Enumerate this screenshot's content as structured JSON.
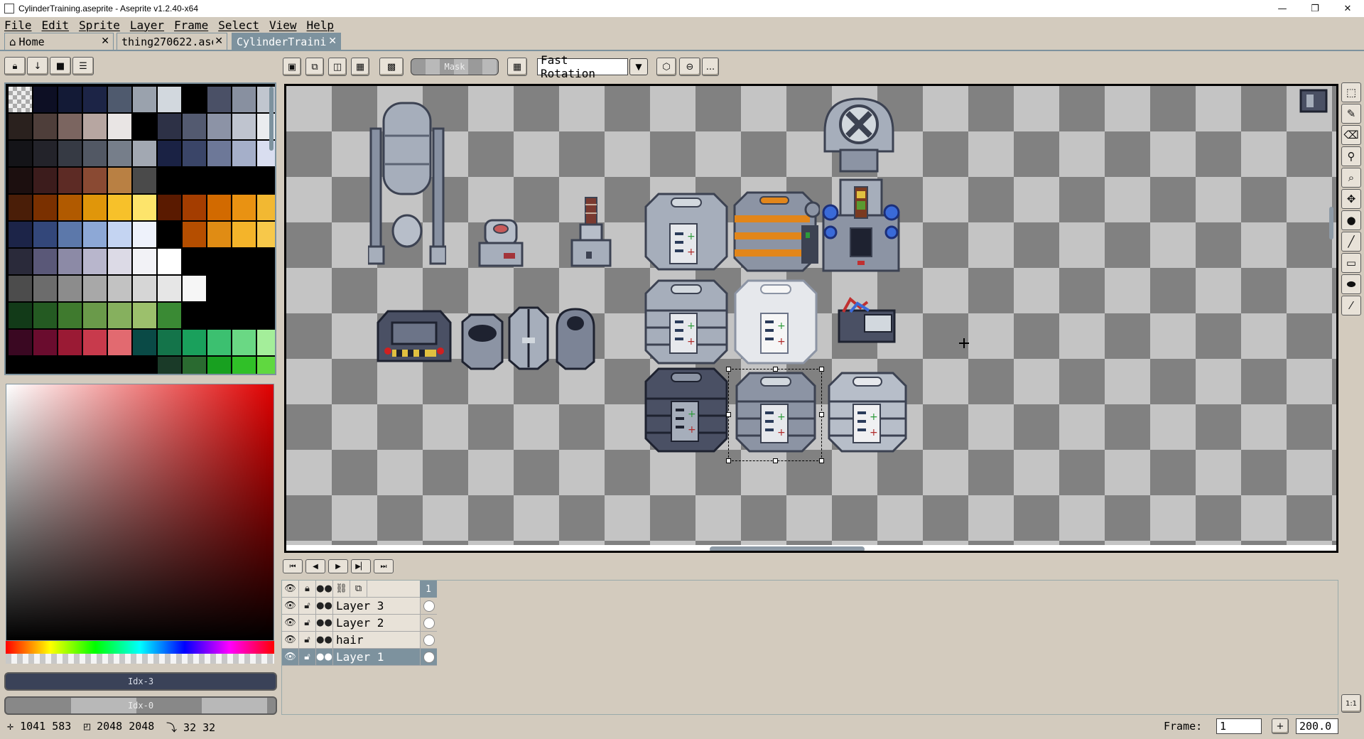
{
  "window": {
    "title": "CylinderTraining.aseprite - Aseprite v1.2.40-x64",
    "minimize": "—",
    "restore": "❐",
    "close": "✕"
  },
  "menu": [
    "File",
    "Edit",
    "Sprite",
    "Layer",
    "Frame",
    "Select",
    "View",
    "Help"
  ],
  "tabs": [
    {
      "label": "Home",
      "icon": "home-icon",
      "close": "✕"
    },
    {
      "label": "thing270622.ase",
      "close": "✕"
    },
    {
      "label": "CylinderTrainin",
      "close": "✕"
    }
  ],
  "context_bar": {
    "mask_label": "Mask",
    "rotation_algorithm": "Fast Rotation",
    "more_label": "..."
  },
  "palette": {
    "colors": [
      "#c8c8c8",
      "#0d0f24",
      "#131a36",
      "#1c2446",
      "#4f5a6e",
      "#9aa2ad",
      "#d2d8de",
      "#000000",
      "#4a5066",
      "#8890a0",
      "#c0c6cf",
      "#2a211e",
      "#4e3e3a",
      "#7b6560",
      "#b7a6a1",
      "#e9e5e4",
      "#000000",
      "#2d3146",
      "#535a70",
      "#8c93a6",
      "#bfc4cf",
      "#eaecef",
      "#141418",
      "#23232a",
      "#363a44",
      "#525864",
      "#767e8a",
      "#a2a8b2",
      "#1a2244",
      "#3a4568",
      "#6d7898",
      "#a5afc9",
      "#d9def0",
      "#1c0f0f",
      "#3c1c1c",
      "#5d2b25",
      "#8a4a33",
      "#b98043",
      "#4a4a4a",
      "#000000",
      "#000000",
      "#000000",
      "#000000",
      "#000000",
      "#4a1e08",
      "#7a3000",
      "#b15a00",
      "#e0960a",
      "#f7c12a",
      "#fde46b",
      "#5a1a00",
      "#a43d00",
      "#d26a00",
      "#e99212",
      "#f2b832",
      "#1c2448",
      "#33477a",
      "#5c78aa",
      "#8da8d6",
      "#c4d4f2",
      "#eef2fb",
      "#000000",
      "#b54e00",
      "#e08c14",
      "#f4b42a",
      "#f7c84a",
      "#2a2a3a",
      "#5a5878",
      "#8c8aa6",
      "#b8b6cc",
      "#dcdae6",
      "#f2f2f6",
      "#ffffff",
      "#000000",
      "#000000",
      "#000000",
      "#000000",
      "#4c4c4c",
      "#6c6c6c",
      "#8c8c8c",
      "#a8a8a8",
      "#c2c2c2",
      "#d6d6d6",
      "#e6e6e6",
      "#f6f6f6",
      "#000000",
      "#000000",
      "#000000",
      "#123a18",
      "#245a22",
      "#3f7a2e",
      "#6a9a4a",
      "#86b05e",
      "#9cc06c",
      "#3a8a34",
      "#000000",
      "#000000",
      "#000000",
      "#000000",
      "#3a0822",
      "#6a0c2e",
      "#9a1a34",
      "#c83a4c",
      "#e26a70",
      "#0a4a46",
      "#14744a",
      "#1aa05c",
      "#3cc070",
      "#6ad884",
      "#a4ee9a",
      "#000000",
      "#000000",
      "#000000",
      "#000000",
      "#000000",
      "#000000",
      "#1a3a28",
      "#2a6a30",
      "#18a020",
      "#30c028",
      "#60d840"
    ]
  },
  "colorbars": {
    "foreground_label": "Idx-3",
    "foreground_color": "#3a4258",
    "background_label": "Idx-0"
  },
  "timeline": {
    "frame_number": "1",
    "layers": [
      {
        "name": "Layer 3",
        "active": false
      },
      {
        "name": "Layer 2",
        "active": false
      },
      {
        "name": "hair",
        "active": false
      },
      {
        "name": "Layer 1",
        "active": true
      }
    ]
  },
  "status": {
    "cursor": "1041 583",
    "canvas_size": "2048 2048",
    "grid_size": "32 32",
    "frame_label": "Frame:",
    "frame_value": "1",
    "zoom_value": "200.0",
    "one_to_one": "1:1"
  }
}
